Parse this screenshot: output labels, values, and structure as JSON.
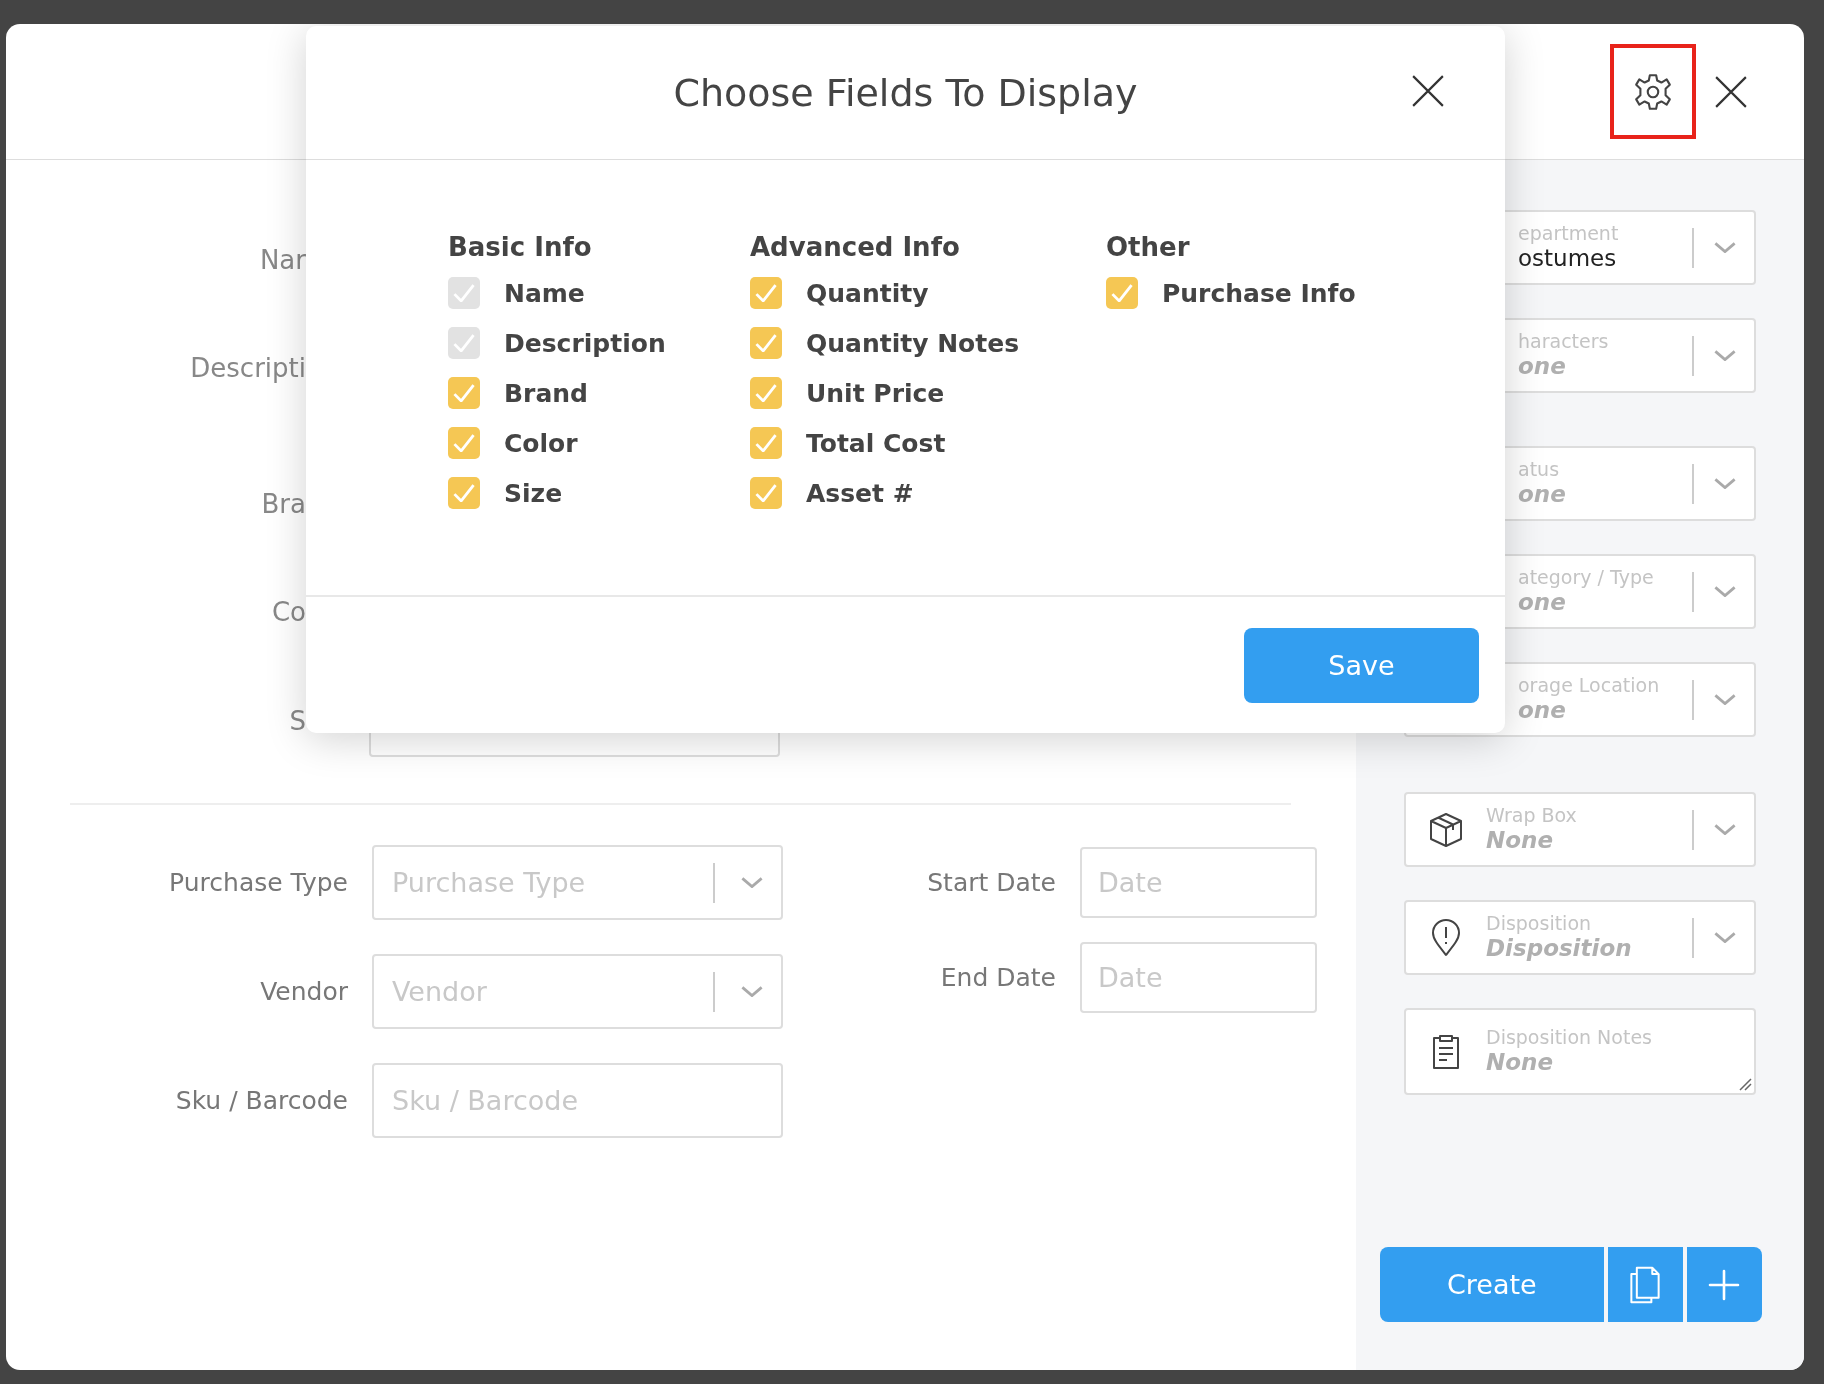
{
  "header": {
    "settings_highlighted": true
  },
  "hidden_form_labels": [
    {
      "label": "Nar"
    },
    {
      "label": "Descripti"
    },
    {
      "label": "Bra"
    },
    {
      "label": "Co"
    },
    {
      "label": "S"
    }
  ],
  "purchase_fields": [
    {
      "kind": "select",
      "label": "Purchase Type",
      "placeholder": "Purchase Type"
    },
    {
      "kind": "select",
      "label": "Vendor",
      "placeholder": "Vendor"
    },
    {
      "kind": "text",
      "label": "Sku / Barcode",
      "placeholder": "Sku / Barcode"
    }
  ],
  "date_fields": [
    {
      "label": "Start Date",
      "placeholder": "Date"
    },
    {
      "label": "End Date",
      "placeholder": "Date"
    }
  ],
  "side_fields": [
    {
      "kind": "select",
      "label": "epartment",
      "value": "ostumes"
    },
    {
      "kind": "select",
      "label": "haracters",
      "placeholder": "one"
    },
    {
      "kind": "select",
      "label": "atus",
      "placeholder": "one"
    },
    {
      "kind": "select",
      "label": "ategory / Type",
      "placeholder": "one"
    },
    {
      "kind": "select",
      "label": "orage Location",
      "placeholder": "one"
    },
    {
      "kind": "boxselect",
      "label": "Wrap Box",
      "placeholder": "None"
    },
    {
      "kind": "pinselect",
      "label": "Disposition",
      "placeholder": "Disposition"
    },
    {
      "kind": "notes",
      "label": "Disposition Notes",
      "placeholder": "None"
    }
  ],
  "actions": {
    "create": "Create"
  },
  "modal": {
    "title": "Choose Fields To Display",
    "groups": [
      {
        "title": "Basic Info",
        "items": [
          {
            "label": "Name",
            "checked": true,
            "disabled": true
          },
          {
            "label": "Description",
            "checked": true,
            "disabled": true
          },
          {
            "label": "Brand",
            "checked": true,
            "disabled": false
          },
          {
            "label": "Color",
            "checked": true,
            "disabled": false
          },
          {
            "label": "Size",
            "checked": true,
            "disabled": false
          }
        ]
      },
      {
        "title": "Advanced Info",
        "items": [
          {
            "label": "Quantity",
            "checked": true,
            "disabled": false
          },
          {
            "label": "Quantity Notes",
            "checked": true,
            "disabled": false
          },
          {
            "label": "Unit Price",
            "checked": true,
            "disabled": false
          },
          {
            "label": "Total Cost",
            "checked": true,
            "disabled": false
          },
          {
            "label": "Asset #",
            "checked": true,
            "disabled": false
          }
        ]
      },
      {
        "title": "Other",
        "items": [
          {
            "label": "Purchase Info",
            "checked": true,
            "disabled": false
          }
        ]
      }
    ],
    "save": "Save"
  }
}
